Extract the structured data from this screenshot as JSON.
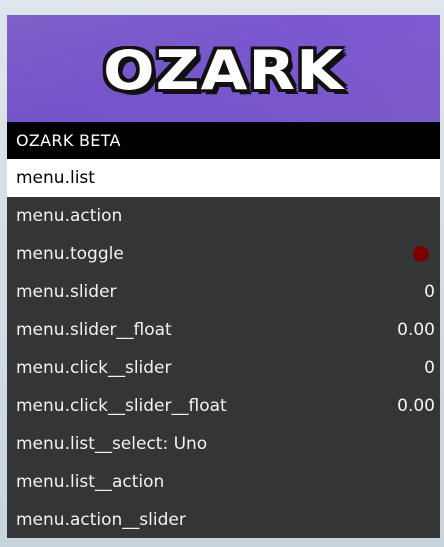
{
  "banner": {
    "logo_text": "OZARK",
    "accent_color": "#7656cc"
  },
  "subtitle": "OZARK BETA",
  "items": [
    {
      "label": "menu.list",
      "value": "",
      "selected": true
    },
    {
      "label": "menu.action",
      "value": ""
    },
    {
      "label": "menu.toggle",
      "value": "",
      "toggle_state": "off",
      "toggle_color": "#7a0000"
    },
    {
      "label": "menu.slider",
      "value": "0"
    },
    {
      "label": "menu.slider__float",
      "value": "0.00"
    },
    {
      "label": "menu.click__slider",
      "value": "0"
    },
    {
      "label": "menu.click__slider__float",
      "value": "0.00"
    },
    {
      "label": "menu.list__select: Uno",
      "value": ""
    },
    {
      "label": "menu.list__action",
      "value": ""
    },
    {
      "label": "menu.action__slider",
      "value": ""
    }
  ]
}
